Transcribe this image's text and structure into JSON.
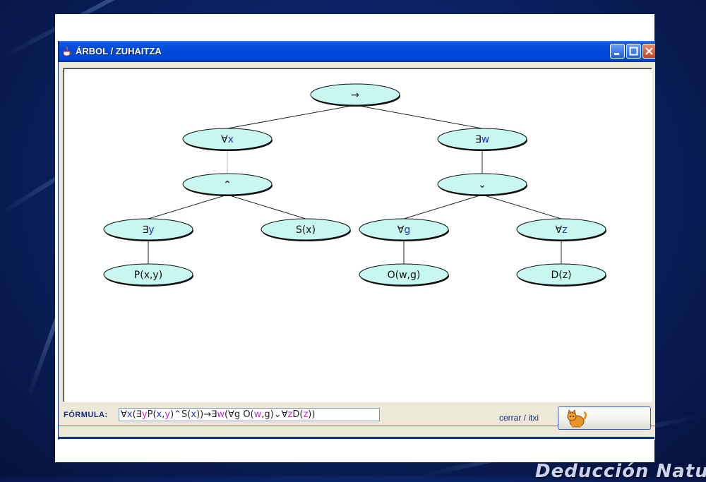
{
  "window": {
    "title": "ÁRBOL / ZUHAITZA"
  },
  "tree": {
    "nodes": [
      {
        "id": "root",
        "op": "→",
        "var": ""
      },
      {
        "id": "forall-x",
        "op": "∀",
        "var": "x"
      },
      {
        "id": "exists-w",
        "op": "∃",
        "var": "w"
      },
      {
        "id": "and",
        "op": "⌃",
        "var": ""
      },
      {
        "id": "or",
        "op": "⌄",
        "var": ""
      },
      {
        "id": "exists-y",
        "op": "∃",
        "var": "y"
      },
      {
        "id": "s-x",
        "op": "S(x)",
        "var": ""
      },
      {
        "id": "forall-g",
        "op": "∀",
        "var": "g"
      },
      {
        "id": "forall-z",
        "op": "∀",
        "var": "z"
      },
      {
        "id": "p-xy",
        "op": "P(x,y)",
        "var": ""
      },
      {
        "id": "o-wg",
        "op": "O(w,g)",
        "var": ""
      },
      {
        "id": "d-z",
        "op": "D(z)",
        "var": ""
      }
    ],
    "edges": [
      [
        "root",
        "forall-x"
      ],
      [
        "root",
        "exists-w"
      ],
      [
        "forall-x",
        "and"
      ],
      [
        "exists-w",
        "or"
      ],
      [
        "and",
        "exists-y"
      ],
      [
        "and",
        "s-x"
      ],
      [
        "or",
        "forall-g"
      ],
      [
        "or",
        "forall-z"
      ],
      [
        "exists-y",
        "p-xy"
      ],
      [
        "forall-g",
        "o-wg"
      ],
      [
        "forall-z",
        "d-z"
      ]
    ]
  },
  "formula": {
    "label": "FÓRMULA:",
    "parts": [
      {
        "t": "∀",
        "c": "plain"
      },
      {
        "t": "x",
        "c": "blue"
      },
      {
        "t": "(∃",
        "c": "plain"
      },
      {
        "t": "y",
        "c": "mag"
      },
      {
        "t": "P(",
        "c": "plain"
      },
      {
        "t": "x",
        "c": "blue"
      },
      {
        "t": ",",
        "c": "plain"
      },
      {
        "t": "y",
        "c": "mag"
      },
      {
        "t": ")⌃S(",
        "c": "plain"
      },
      {
        "t": "x",
        "c": "blue"
      },
      {
        "t": "))→∃",
        "c": "plain"
      },
      {
        "t": "w",
        "c": "mag"
      },
      {
        "t": "(∀g O(",
        "c": "plain"
      },
      {
        "t": "w",
        "c": "mag"
      },
      {
        "t": ",g)⌄∀",
        "c": "plain"
      },
      {
        "t": "z",
        "c": "mag"
      },
      {
        "t": "D(",
        "c": "plain"
      },
      {
        "t": "z",
        "c": "mag"
      },
      {
        "t": "))",
        "c": "plain"
      }
    ]
  },
  "close": {
    "label": "cerrar / itxi"
  },
  "footer": {
    "title": "Deducción Natural"
  },
  "colors": {
    "node_fill": "#c8f7f0",
    "variable_blue": "#2332c8",
    "variable_magenta": "#c82bd0",
    "titlebar": "#0047d6"
  }
}
